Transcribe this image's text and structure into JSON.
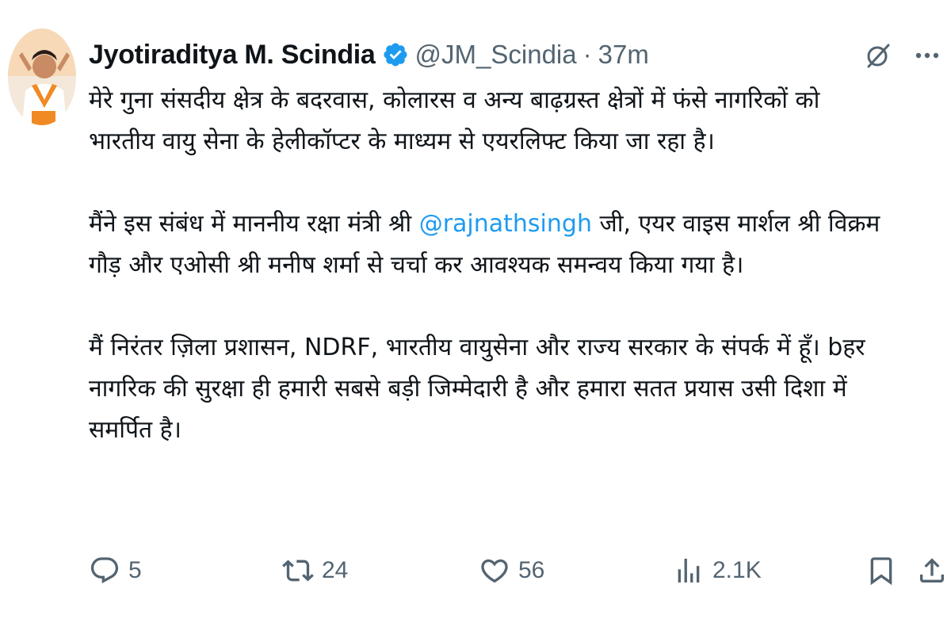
{
  "tweet": {
    "author": {
      "display_name": "Jyotiraditya M. Scindia",
      "handle": "@JM_Scindia",
      "separator": "·",
      "timestamp": "37m",
      "verified_icon": "verified-badge-icon",
      "verified_color": "#1d9bf0"
    },
    "paragraph_1": {
      "line_1": "मेरे गुना संसदीय क्षेत्र के बदरवास, कोलारस व अन्य बाढ़ग्रस्त क्षेत्रों में फंसे नागरिकों को",
      "line_2": "भारतीय वायु सेना के हेलीकॉप्टर के माध्यम से एयरलिफ्ट किया जा रहा है।"
    },
    "paragraph_2": {
      "line_1_before": "मैंने इस संबंध में माननीय रक्षा मंत्री श्री ",
      "mention": "@rajnathsingh",
      "line_1_after": " जी, एयर वाइस मार्शल श्री विक्रम",
      "line_2": "गौड़ और एओसी श्री मनीष शर्मा से चर्चा कर आवश्यक समन्वय किया गया है।"
    },
    "paragraph_3": {
      "line_1": "मैं निरंतर ज़िला प्रशासन, NDRF, भारतीय वायुसेना और राज्य सरकार के संपर्क में हूँ। bहर",
      "line_2": "नागरिक की सुरक्षा ही हमारी सबसे बड़ी जिम्मेदारी है और हमारा सतत प्रयास उसी दिशा में",
      "line_3": "समर्पित है।"
    },
    "mention_color": "#1d9bf0",
    "actions": {
      "reply_count": "5",
      "repost_count": "24",
      "like_count": "56",
      "views_count": "2.1K"
    },
    "icons": {
      "reply": "reply-icon",
      "repost": "repost-icon",
      "like": "heart-icon",
      "views": "views-icon",
      "bookmark": "bookmark-icon",
      "share": "share-icon",
      "grok": "grok-icon",
      "more": "more-icon"
    },
    "muted_color": "#536471"
  }
}
